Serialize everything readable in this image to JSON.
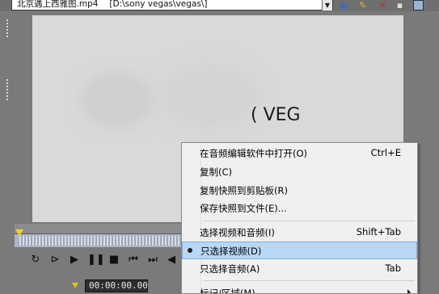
{
  "topbar": {
    "file_name": "北京遇上西雅图.mp4",
    "file_path": "[D:\\sony vegas\\vegas\\]",
    "icons": [
      "properties-icon",
      "effects-icon",
      "remove-icon",
      "dock-icon"
    ],
    "colors": {
      "remove": "#c0302a",
      "effects": "#e2b630",
      "properties": "#3b6db5"
    }
  },
  "preview": {
    "watermark": "( VEG"
  },
  "transport": {
    "buttons": [
      "loop-icon",
      "play-from-start-icon",
      "play-icon",
      "pause-icon",
      "stop-icon",
      "prev-frame-icon",
      "next-frame-icon",
      "mark-in-icon"
    ],
    "timecode": "00:00:00.00"
  },
  "menu": {
    "items": [
      {
        "label": "在音频编辑软件中打开(O)",
        "shortcut": "Ctrl+E"
      },
      {
        "label": "复制(C)",
        "shortcut": ""
      },
      {
        "label": "复制快照到剪贴板(R)",
        "shortcut": ""
      },
      {
        "label": "保存快照到文件(E)...",
        "shortcut": ""
      },
      {
        "label": "选择视频和音频(I)",
        "shortcut": "Shift+Tab"
      },
      {
        "label": "只选择视频(D)",
        "shortcut": "",
        "selected": true,
        "highlighted": true
      },
      {
        "label": "只选择音频(A)",
        "shortcut": "Tab"
      },
      {
        "label": "标记/区域(M)",
        "shortcut": "",
        "submenu": true
      }
    ],
    "highlight_color": "#b8d7f5"
  }
}
